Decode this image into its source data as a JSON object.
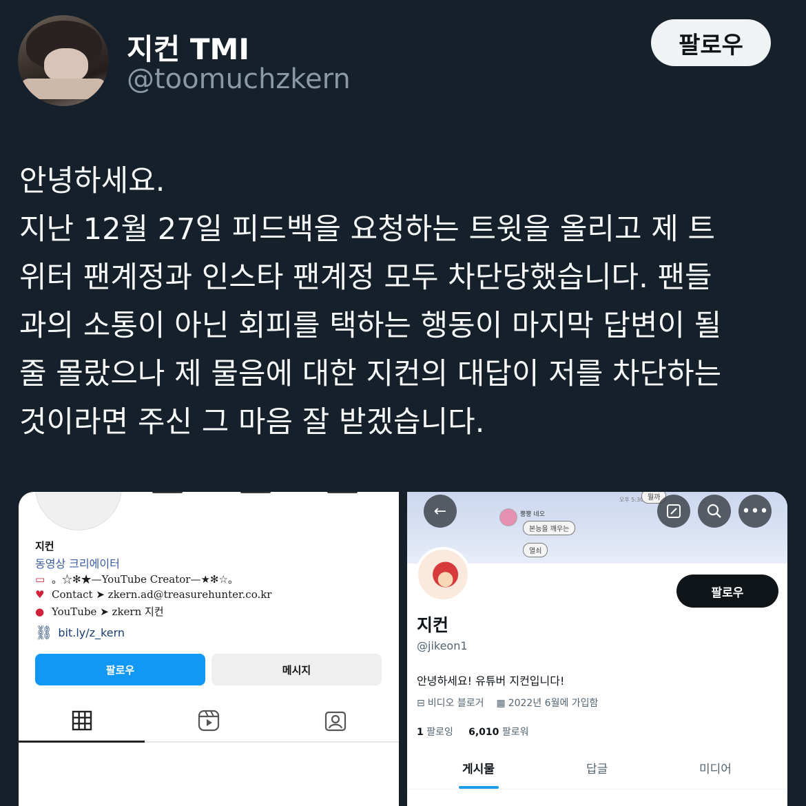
{
  "tweet": {
    "display_name": "지컨 TMI",
    "handle": "@toomuchzkern",
    "follow_label": "팔로우",
    "lines": [
      "안녕하세요.",
      "지난 12월 27일 피드백을 요청하는 트윗을 올리고 제 트",
      "위터 팬계정과 인스타 팬계정 모두 차단당했습니다. 팬들",
      "과의 소통이 아닌 회피를 택하는 행동이 마지막 답변이 될",
      "줄 몰랐으나 제 물음에 대한 지컨의 대답이 저를 차단하는",
      "것이라면 주신 그 마음 잘 받겠습니다."
    ]
  },
  "instagram": {
    "name": "지컨",
    "category": "동영상 크리에이터",
    "bio_line_1": "。☆✻★—YouTube Creator—★✻☆。",
    "bio_line_2": "Contact ➤ zkern.ad@treasurehunter.co.kr",
    "bio_line_3": "YouTube ➤ zkern 지컨",
    "link": "bit.ly/z_kern",
    "follow_label": "팔로우",
    "message_label": "메시지",
    "icons": {
      "flag": "korea-flag-icon",
      "contact": "heart-letter-icon",
      "youtube": "strawberry-icon",
      "link": "link-icon",
      "grid": "grid-icon",
      "reels": "reels-icon",
      "tagged": "tagged-icon"
    }
  },
  "twitter_profile": {
    "banner": {
      "chat_name": "뿡뿡 네오",
      "bubble_1": "본능을 깨우는",
      "bubble_2": "열쇠",
      "bubble_top": "뭘까",
      "time": "오후 5:30"
    },
    "follow_label": "팔로우",
    "name": "지컨",
    "handle": "@jikeon1",
    "bio": "안녕하세요! 유튜버 지컨입니다!",
    "category": "비디오 블로거",
    "joined": "2022년 6월에 가입함",
    "following_count": "1",
    "following_label": "팔로잉",
    "followers_count": "6,010",
    "followers_label": "팔로워",
    "tabs": [
      "게시물",
      "답글",
      "미디어"
    ],
    "active_tab": "게시물",
    "accent": "#1d9bf0"
  }
}
